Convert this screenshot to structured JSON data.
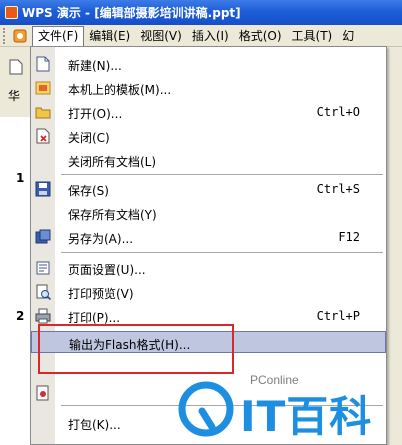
{
  "window": {
    "title": "WPS 演示 - [编辑部摄影培训讲稿.ppt]"
  },
  "menubar": {
    "items": [
      {
        "label": "文件(F)",
        "active": true
      },
      {
        "label": "编辑(E)"
      },
      {
        "label": "视图(V)"
      },
      {
        "label": "插入(I)"
      },
      {
        "label": "格式(O)"
      },
      {
        "label": "工具(T)"
      },
      {
        "label": "幻"
      }
    ]
  },
  "left": {
    "label": "华",
    "slides": [
      "1",
      "2"
    ]
  },
  "file_menu": {
    "items": [
      {
        "label": "新建(N)...",
        "icon": "new-document-icon"
      },
      {
        "label": "本机上的模板(M)...",
        "icon": "template-icon"
      },
      {
        "label": "打开(O)...",
        "shortcut": "Ctrl+O",
        "icon": "open-folder-icon"
      },
      {
        "label": "关闭(C)",
        "icon": "close-document-icon"
      },
      {
        "label": "关闭所有文档(L)"
      },
      {
        "label": "保存(S)",
        "shortcut": "Ctrl+S",
        "icon": "save-icon"
      },
      {
        "label": "保存所有文档(Y)"
      },
      {
        "label": "另存为(A)...",
        "shortcut": "F12",
        "icon": "save-as-icon"
      },
      {
        "label": "页面设置(U)...",
        "icon": "page-setup-icon"
      },
      {
        "label": "打印预览(V)",
        "icon": "print-preview-icon"
      },
      {
        "label": "打印(P)...",
        "shortcut": "Ctrl+P",
        "icon": "print-icon"
      },
      {
        "label": "输出为Flash格式(H)...",
        "highlighted": true
      },
      {
        "label": "打包(K)..."
      }
    ]
  },
  "watermark": {
    "small": "PConline",
    "big": "IT百科"
  }
}
